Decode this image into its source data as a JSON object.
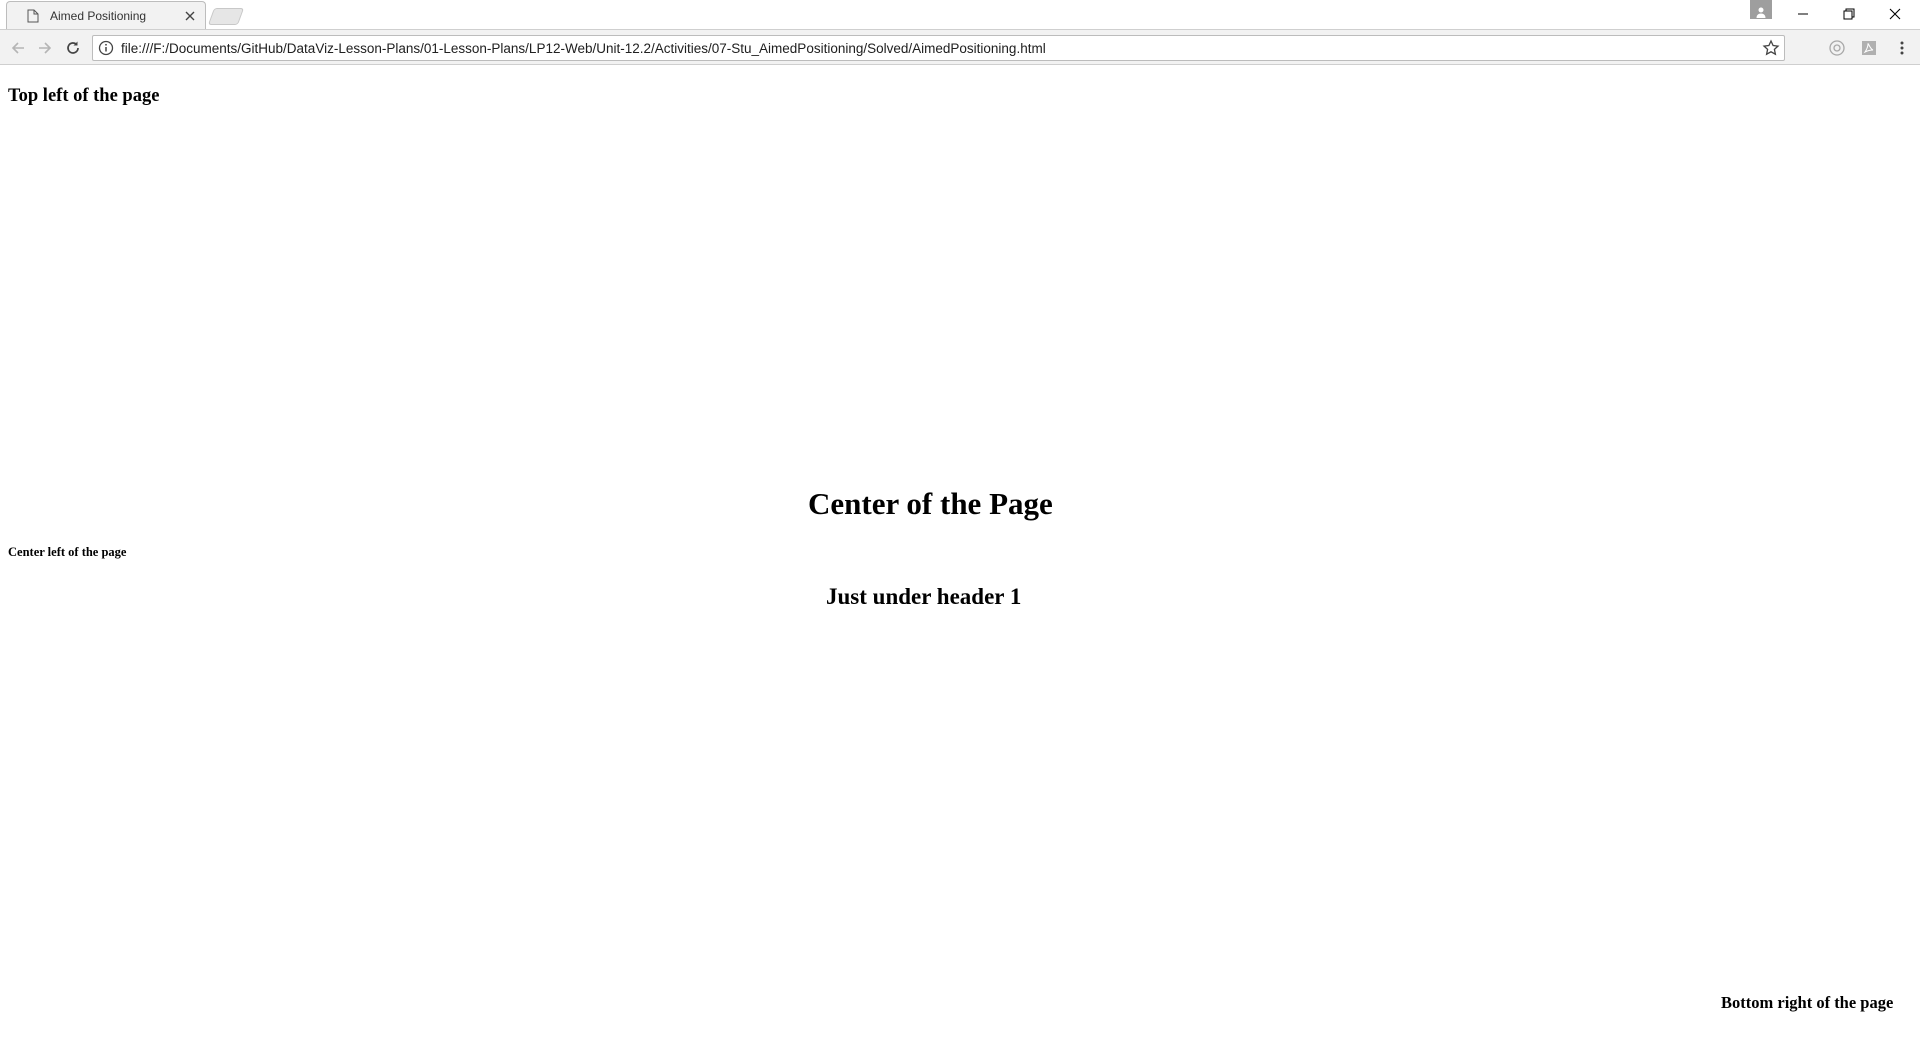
{
  "browser": {
    "tab_title": "Aimed Positioning",
    "url": "file:///F:/Documents/GitHub/DataViz-Lesson-Plans/01-Lesson-Plans/LP12-Web/Unit-12.2/Activities/07-Stu_AimedPositioning/Solved/AimedPositioning.html"
  },
  "page": {
    "top_left": "Top left of the page",
    "center_page": "Center of the Page",
    "center_left": "Center left of the page",
    "under_header": "Just under header 1",
    "bottom_right": "Bottom right of the page"
  },
  "icons": {
    "tab_icon": "document-icon",
    "tab_close": "close-icon",
    "back": "back-arrow-icon",
    "forward": "forward-arrow-icon",
    "reload": "reload-icon",
    "info": "info-icon",
    "bookmark": "star-icon",
    "extension_1": "extension-circle-icon",
    "extension_2": "pdf-icon",
    "menu": "kebab-menu-icon",
    "profile": "profile-icon",
    "minimize": "minimize-icon",
    "restore": "restore-icon",
    "close_window": "close-window-icon"
  }
}
